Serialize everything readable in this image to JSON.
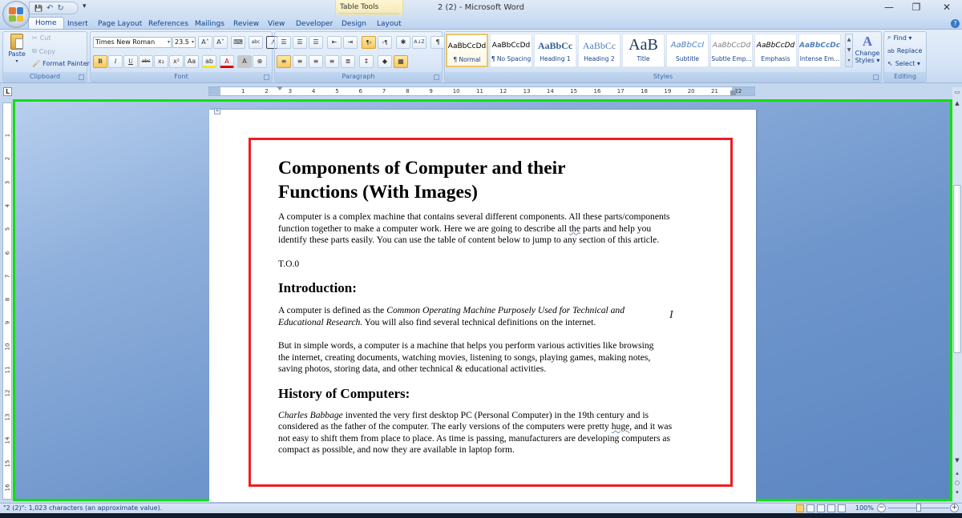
{
  "window": {
    "title": "2 (2) - Microsoft Word",
    "contextual_group": "Table Tools",
    "controls": {
      "minimize": "—",
      "restore": "❐",
      "close": "✕"
    }
  },
  "quick_access": {
    "save": "💾",
    "undo": "↶",
    "redo": "↻",
    "customize": "▾"
  },
  "tabs": [
    {
      "label": "Home",
      "active": true
    },
    {
      "label": "Insert"
    },
    {
      "label": "Page Layout"
    },
    {
      "label": "References"
    },
    {
      "label": "Mailings"
    },
    {
      "label": "Review"
    },
    {
      "label": "View"
    },
    {
      "label": "Developer"
    },
    {
      "label": "Design"
    },
    {
      "label": "Layout"
    }
  ],
  "help": "?",
  "ribbon": {
    "clipboard": {
      "label": "Clipboard",
      "paste": "Paste",
      "cut": "Cut",
      "copy": "Copy",
      "format_painter": "Format Painter"
    },
    "font": {
      "label": "Font",
      "font_name": "Times New Roman",
      "font_size": "23.5",
      "grow": "A˄",
      "shrink": "A˅",
      "clear": "⌨",
      "phonetic": "abc",
      "border": "A",
      "bold": "B",
      "italic": "I",
      "underline": "U",
      "strike": "abc",
      "subscript": "x₂",
      "superscript": "x²",
      "change_case": "Aa",
      "highlight": "ab",
      "font_color": "A",
      "shading": "A",
      "enclose": "⊕",
      "highlight_color": "#ffe600",
      "font_color_value": "#e00000"
    },
    "paragraph": {
      "label": "Paragraph",
      "bullets": "☰",
      "numbering": "☰",
      "multilevel": "☰",
      "dec_indent": "⇤",
      "inc_indent": "⇥",
      "ltr": "¶›",
      "rtl": "‹¶",
      "asian_layout": "✱",
      "sort": "A↓Z",
      "show_marks": "¶",
      "align_left": "≡",
      "center": "≡",
      "align_right": "≡",
      "justify": "≡",
      "distributed": "≣",
      "line_spacing": "↕",
      "shading": "◆",
      "borders": "▦"
    },
    "styles": {
      "label": "Styles",
      "items": [
        {
          "preview": "AaBbCcDd",
          "name": "¶ Normal",
          "selected": true
        },
        {
          "preview": "AaBbCcDd",
          "name": "¶ No Spacing"
        },
        {
          "preview": "AaBbCc",
          "name": "Heading 1"
        },
        {
          "preview": "AaBbCc",
          "name": "Heading 2"
        },
        {
          "preview": "AaB",
          "name": "Title"
        },
        {
          "preview": "AaBbCcI",
          "name": "Subtitle"
        },
        {
          "preview": "AaBbCcDd",
          "name": "Subtle Emp..."
        },
        {
          "preview": "AaBbCcDd",
          "name": "Emphasis"
        },
        {
          "preview": "AaBbCcDc",
          "name": "Intense Em..."
        }
      ],
      "change_styles_line1": "Change",
      "change_styles_line2": "Styles ▾"
    },
    "editing": {
      "label": "Editing",
      "find": "Find ▾",
      "replace": "Replace",
      "select": "Select ▾"
    }
  },
  "ruler": {
    "corner": "L",
    "h_ticks": [
      "1",
      "2",
      "3",
      "4",
      "5",
      "6",
      "7",
      "8",
      "9",
      "10",
      "11",
      "12",
      "13",
      "14",
      "15",
      "16",
      "17",
      "18",
      "19",
      "20",
      "21",
      "22"
    ],
    "v_ticks": [
      "1",
      "2",
      "3",
      "4",
      "5",
      "6",
      "7",
      "8",
      "9",
      "10",
      "11",
      "12",
      "13",
      "14",
      "15",
      "16"
    ]
  },
  "document": {
    "title": "Components of Computer and their Functions (With Images)",
    "intro_p1": "A computer is a complex machine that contains several different components. All these parts/components function together to make a computer work. Here we are going to describe all ",
    "intro_p1_squig": "the",
    "intro_p1_end": " parts and help you identify these parts easily. You can use the table of content below to jump to any section of this article.",
    "toc": "T.O.0",
    "h_intro": "Introduction:",
    "def_start": "A computer is defined as the ",
    "def_italic": "Common Operating Machine Purposely Used for Technical and Educational Research.",
    "def_end": "  You will also find several technical definitions on the internet.",
    "simple": "But in simple words, a computer is a machine that helps you perform various activities like browsing the internet, creating documents, watching movies, listening to songs, playing games, making notes, saving photos, storing data, and other technical & educational activities.",
    "h_history": "History of Computers:",
    "hist_italic": "Charles  Babbage",
    "hist_p1": "  invented the very first desktop PC (Personal Computer) in the 19th century and is considered as the father of the computer. The early versions of the computers were pretty ",
    "hist_squig": "huge",
    "hist_p2": ", and it was not easy to shift them from place to place. As time is passing, manufacturers are developing computers as compact as possible, and now they are available in laptop form."
  },
  "status": {
    "text": "\"2 (2)\": 1,023 characters (an approximate value).",
    "zoom": "100%",
    "zoom_out": "−",
    "zoom_in": "+",
    "zoom_level_percent": 100
  }
}
